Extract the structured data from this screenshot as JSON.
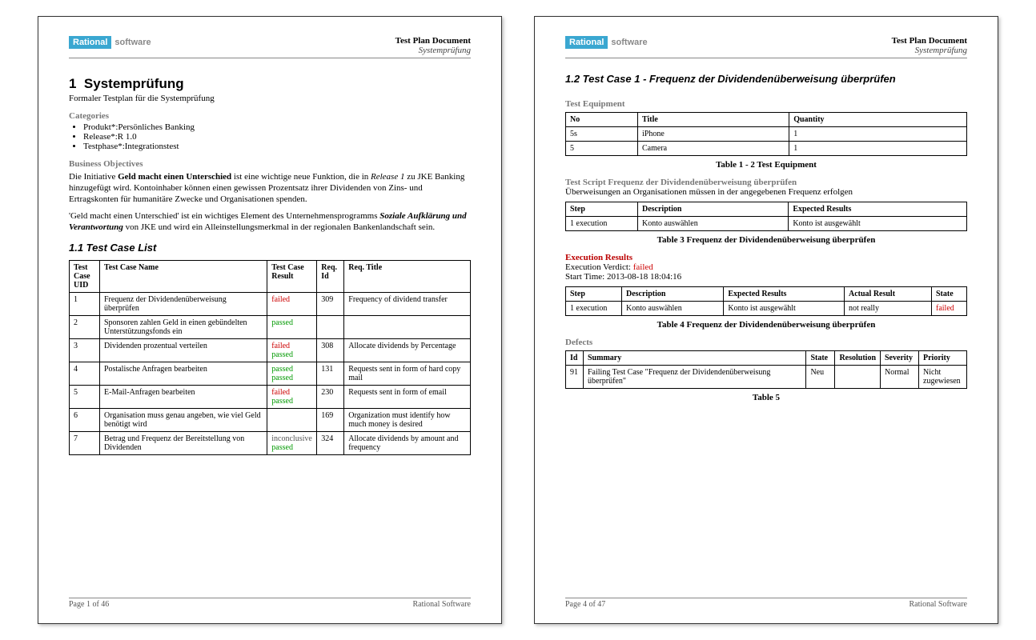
{
  "header": {
    "logo_left": "Rational",
    "logo_right": "software",
    "title": "Test Plan Document",
    "subtitle": "Systemprüfung"
  },
  "page1": {
    "section_no": "1",
    "section_title": "Systemprüfung",
    "subtitle": "Formaler Testplan für die Systemprüfung",
    "cat_label": "Categories",
    "cats": [
      "Produkt*:Persönliches Banking",
      "Release*:R 1.0",
      "Testphase*:Integrationstest"
    ],
    "bo_label": "Business Objectives",
    "bo_p1a": "Die Initiative ",
    "bo_p1b": "Geld macht einen Unterschied",
    "bo_p1c": " ist eine wichtige neue Funktion, die in ",
    "bo_p1d": "Release 1",
    "bo_p1e": " zu JKE Banking hinzugefügt wird. Kontoinhaber können einen gewissen Prozentsatz ihrer Dividenden von Zins- und Ertragskonten für humanitäre Zwecke und Organisationen spenden.",
    "bo_p2a": "'Geld macht einen Unterschied' ist ein wichtiges Element des Unternehmensprogramms ",
    "bo_p2b": "Soziale Aufklärung und Verantwortung",
    "bo_p2c": " von JKE und wird ein Alleinstellungsmerkmal in der regionalen Bankenlandschaft sein.",
    "tcl_heading": "1.1  Test Case List",
    "tcl_heads": [
      "Test Case UID",
      "Test Case Name",
      "Test Case Result",
      "Req. Id",
      "Req. Title"
    ],
    "tcl_rows": [
      {
        "uid": "1",
        "name": "Frequenz der Dividendenüberweisung überprüfen",
        "results": [
          {
            "txt": "failed",
            "cls": "failed"
          }
        ],
        "rid": "309",
        "rtitle": "Frequency of dividend transfer"
      },
      {
        "uid": "2",
        "name": "Sponsoren zahlen Geld in einen gebündelten Unterstützungsfonds ein",
        "results": [
          {
            "txt": "passed",
            "cls": "passed"
          }
        ],
        "rid": "",
        "rtitle": ""
      },
      {
        "uid": "3",
        "name": "Dividenden prozentual verteilen",
        "results": [
          {
            "txt": "failed",
            "cls": "failed"
          },
          {
            "txt": "passed",
            "cls": "passed"
          }
        ],
        "rid": "308",
        "rtitle": "Allocate dividends by Percentage"
      },
      {
        "uid": "4",
        "name": "Postalische Anfragen bearbeiten",
        "results": [
          {
            "txt": "passed",
            "cls": "passed"
          },
          {
            "txt": "passed",
            "cls": "passed"
          }
        ],
        "rid": "131",
        "rtitle": "Requests sent in form of hard copy mail"
      },
      {
        "uid": "5",
        "name": "E-Mail-Anfragen bearbeiten",
        "results": [
          {
            "txt": "failed",
            "cls": "failed"
          },
          {
            "txt": "passed",
            "cls": "passed"
          }
        ],
        "rid": "230",
        "rtitle": "Requests sent in form of email"
      },
      {
        "uid": "6",
        "name": "Organisation muss genau angeben, wie viel Geld benötigt wird",
        "results": [],
        "rid": "169",
        "rtitle": "Organization must identify how much money is desired"
      },
      {
        "uid": "7",
        "name": "Betrag und Frequenz der Bereitstellung von Dividenden",
        "results": [
          {
            "txt": "inconclusive",
            "cls": "inconclusive"
          },
          {
            "txt": "passed",
            "cls": "passed"
          }
        ],
        "rid": "324",
        "rtitle": "Allocate dividends by amount and frequency"
      }
    ],
    "footer_left": "Page 1 of  46",
    "footer_right": "Rational Software"
  },
  "page2": {
    "heading": "1.2  Test Case 1 - Frequenz der Dividendenüberweisung überprüfen",
    "te_label": "Test Equipment",
    "te_heads": [
      "No",
      "Title",
      "Quantity"
    ],
    "te_rows": [
      {
        "no": "5s",
        "title": "iPhone",
        "qty": "1"
      },
      {
        "no": "5",
        "title": "Camera",
        "qty": "1"
      }
    ],
    "te_caption": "Table 1 - 2 Test Equipment",
    "ts_label": "Test Script Frequenz der Dividendenüberweisung überprüfen",
    "ts_desc": "Überweisungen an Organisationen müssen in der angegebenen Frequenz erfolgen",
    "ts_heads": [
      "Step",
      "Description",
      "Expected Results"
    ],
    "ts_rows": [
      {
        "step": "1 execution",
        "desc": "Konto auswählen",
        "exp": "Konto ist ausgewählt"
      }
    ],
    "ts_caption": "Table 3 Frequenz der Dividendenüberweisung überprüfen",
    "er_label": "Execution Results",
    "er_verdict_label": "Execution Verdict: ",
    "er_verdict": "failed",
    "er_start": "Start Time: 2013-08-18 18:04:16",
    "er_heads": [
      "Step",
      "Description",
      "Expected Results",
      "Actual Result",
      "State"
    ],
    "er_rows": [
      {
        "step": "1 execution",
        "desc": "Konto auswählen",
        "exp": "Konto ist ausgewählt",
        "act": "not really",
        "state": "failed"
      }
    ],
    "er_caption": "Table 4 Frequenz der Dividendenüberweisung überprüfen",
    "def_label": "Defects",
    "def_heads": [
      "Id",
      "Summary",
      "State",
      "Resolution",
      "Severity",
      "Priority"
    ],
    "def_rows": [
      {
        "id": "91",
        "summary": "Failing Test Case \"Frequenz der Dividendenüberweisung überprüfen\"",
        "state": "Neu",
        "res": "",
        "sev": "Normal",
        "pri": "Nicht zugewiesen"
      }
    ],
    "def_caption": "Table 5",
    "footer_left": "Page 4 of  47",
    "footer_right": "Rational Software"
  }
}
